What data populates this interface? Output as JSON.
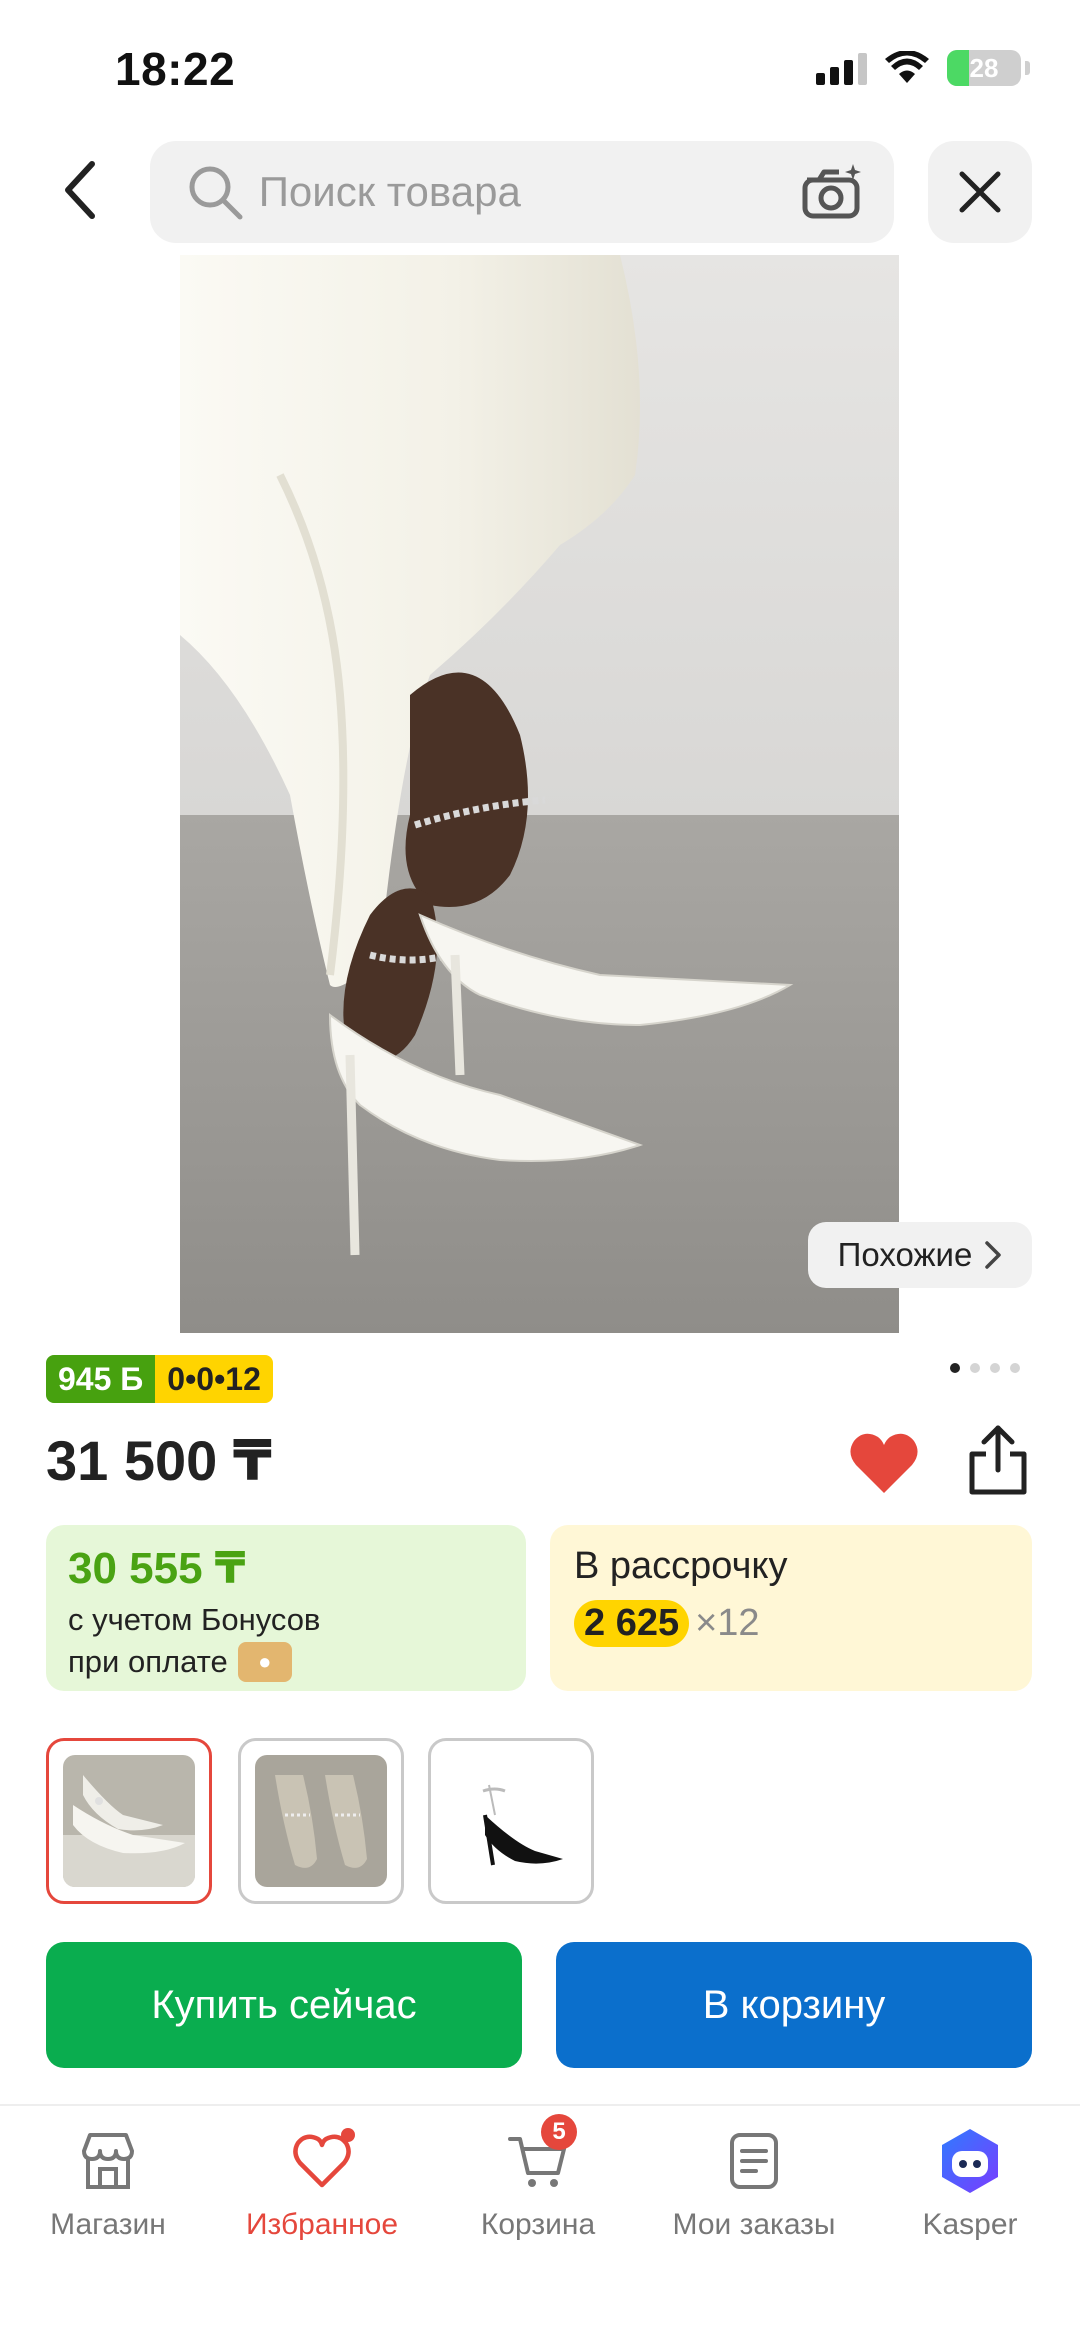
{
  "status_bar": {
    "time": "18:22",
    "battery": "28"
  },
  "header": {
    "search_placeholder": "Поиск товара"
  },
  "product": {
    "similar_label": "Похожие",
    "bonus_badge": "945 Б",
    "installment_badge": "0•0•12",
    "image_count": 4,
    "active_image": 1,
    "price": "31 500 ₸",
    "favorited": true
  },
  "bonus_card": {
    "price": "30 555 ₸",
    "line1": "с учетом Бонусов",
    "line2": "при оплате"
  },
  "installment_card": {
    "title": "В рассрочку",
    "amount": "2 625",
    "multiplier": "×12"
  },
  "thumbnails": [
    {
      "name": "white-satin-heels",
      "selected": true
    },
    {
      "name": "crystal-heels",
      "selected": false
    },
    {
      "name": "black-heels",
      "selected": false
    }
  ],
  "actions": {
    "buy_now": "Купить сейчас",
    "add_to_cart": "В корзину"
  },
  "tabbar": {
    "items": [
      {
        "label": "Магазин",
        "icon": "shop-icon"
      },
      {
        "label": "Избранное",
        "icon": "heart-icon",
        "active": true
      },
      {
        "label": "Корзина",
        "icon": "cart-icon",
        "badge": "5"
      },
      {
        "label": "Мои заказы",
        "icon": "orders-icon"
      },
      {
        "label": "Kasper",
        "icon": "kasper-icon"
      }
    ]
  },
  "colors": {
    "accent_red": "#e5473c",
    "buy_green": "#0aad4f",
    "cart_blue": "#0b6fcc",
    "bonus_green": "#47a10f",
    "installment_yellow": "#ffd400"
  }
}
